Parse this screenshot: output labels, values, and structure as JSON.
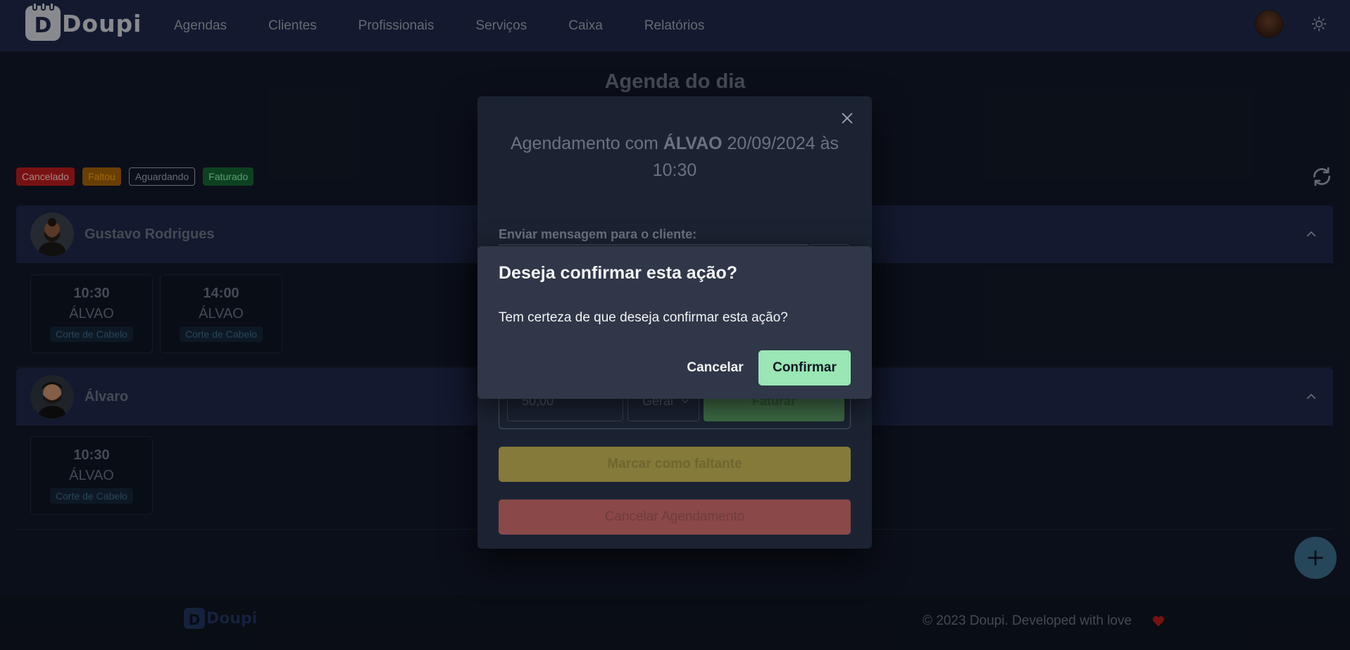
{
  "navbar": {
    "logo_letter": "D",
    "logo_text": "Doupi",
    "items": [
      {
        "label": "Agendas"
      },
      {
        "label": "Clientes"
      },
      {
        "label": "Profissionais"
      },
      {
        "label": "Serviços"
      },
      {
        "label": "Caixa"
      },
      {
        "label": "Relatórios"
      }
    ],
    "theme_icon": "sun-icon"
  },
  "page": {
    "title": "Agenda do dia",
    "legend": [
      {
        "label": "Cancelado",
        "color": "#b91c1c"
      },
      {
        "label": "Faltou",
        "color": "#a16207"
      },
      {
        "label": "Aguardando",
        "color": "#9ca3af"
      },
      {
        "label": "Faturado",
        "color": "#166534"
      }
    ],
    "refresh_icon": "refresh-icon"
  },
  "professionals": [
    {
      "name": "Gustavo Rodrigues",
      "appointments": [
        {
          "time": "10:30",
          "client": "ÁLVAO",
          "service": "Corte de Cabelo"
        },
        {
          "time": "14:00",
          "client": "ÁLVAO",
          "service": "Corte de Cabelo"
        }
      ]
    },
    {
      "name": "Álvaro",
      "appointments": [
        {
          "time": "10:30",
          "client": "ÁLVAO",
          "service": "Corte de Cabelo"
        }
      ]
    }
  ],
  "modal": {
    "title_prefix": "Agendamento com",
    "title_client": "ÁLVAO",
    "title_date": "20/09/2024 às 10:30",
    "message_label": "Enviar mensagem para o cliente:",
    "amount_value": "50,00",
    "payment_select": "Geral",
    "invoice_button": "Faturar",
    "mark_absent_button": "Marcar como faltante",
    "cancel_appointment_button": "Cancelar Agendamento"
  },
  "confirm_dialog": {
    "title": "Deseja confirmar esta ação?",
    "text": "Tem certeza de que deseja confirmar esta ação?",
    "cancel_label": "Cancelar",
    "confirm_label": "Confirmar",
    "confirm_color": "#9ae6b4"
  },
  "footer": {
    "logo_letter": "D",
    "logo_text": "Doupi",
    "copyright": "© 2023 Doupi. Developed with love"
  }
}
